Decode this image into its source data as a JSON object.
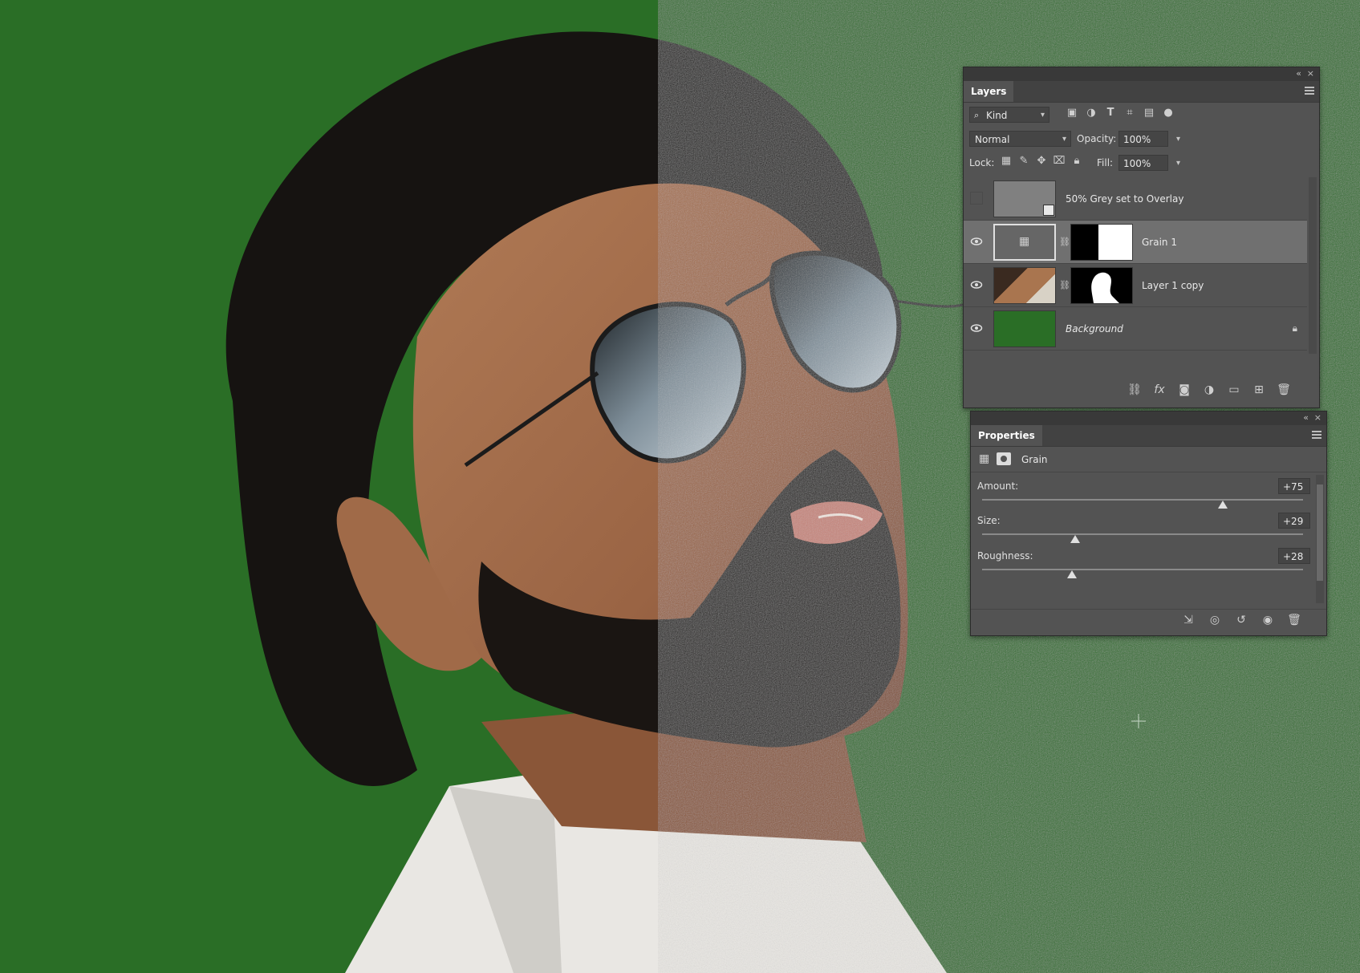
{
  "layers_panel": {
    "tab_label": "Layers",
    "filter": {
      "kind_label": "Kind"
    },
    "blend_mode": "Normal",
    "opacity_label": "Opacity:",
    "opacity_value": "100%",
    "lock_label": "Lock:",
    "fill_label": "Fill:",
    "fill_value": "100%",
    "layers": [
      {
        "name": "50% Grey set to Overlay",
        "visible": false
      },
      {
        "name": "Grain 1",
        "visible": true,
        "selected": true
      },
      {
        "name": "Layer 1 copy",
        "visible": true
      },
      {
        "name": "Background",
        "visible": true,
        "locked": true
      }
    ]
  },
  "properties_panel": {
    "tab_label": "Properties",
    "adjustment_label": "Grain",
    "sliders": [
      {
        "label": "Amount:",
        "value": "+75",
        "fraction": 0.75
      },
      {
        "label": "Size:",
        "value": "+29",
        "fraction": 0.29
      },
      {
        "label": "Roughness:",
        "value": "+28",
        "fraction": 0.28
      }
    ]
  },
  "colors": {
    "background_green": "#2a6e26",
    "panel_bg": "#535353",
    "selected_row": "#707070"
  }
}
